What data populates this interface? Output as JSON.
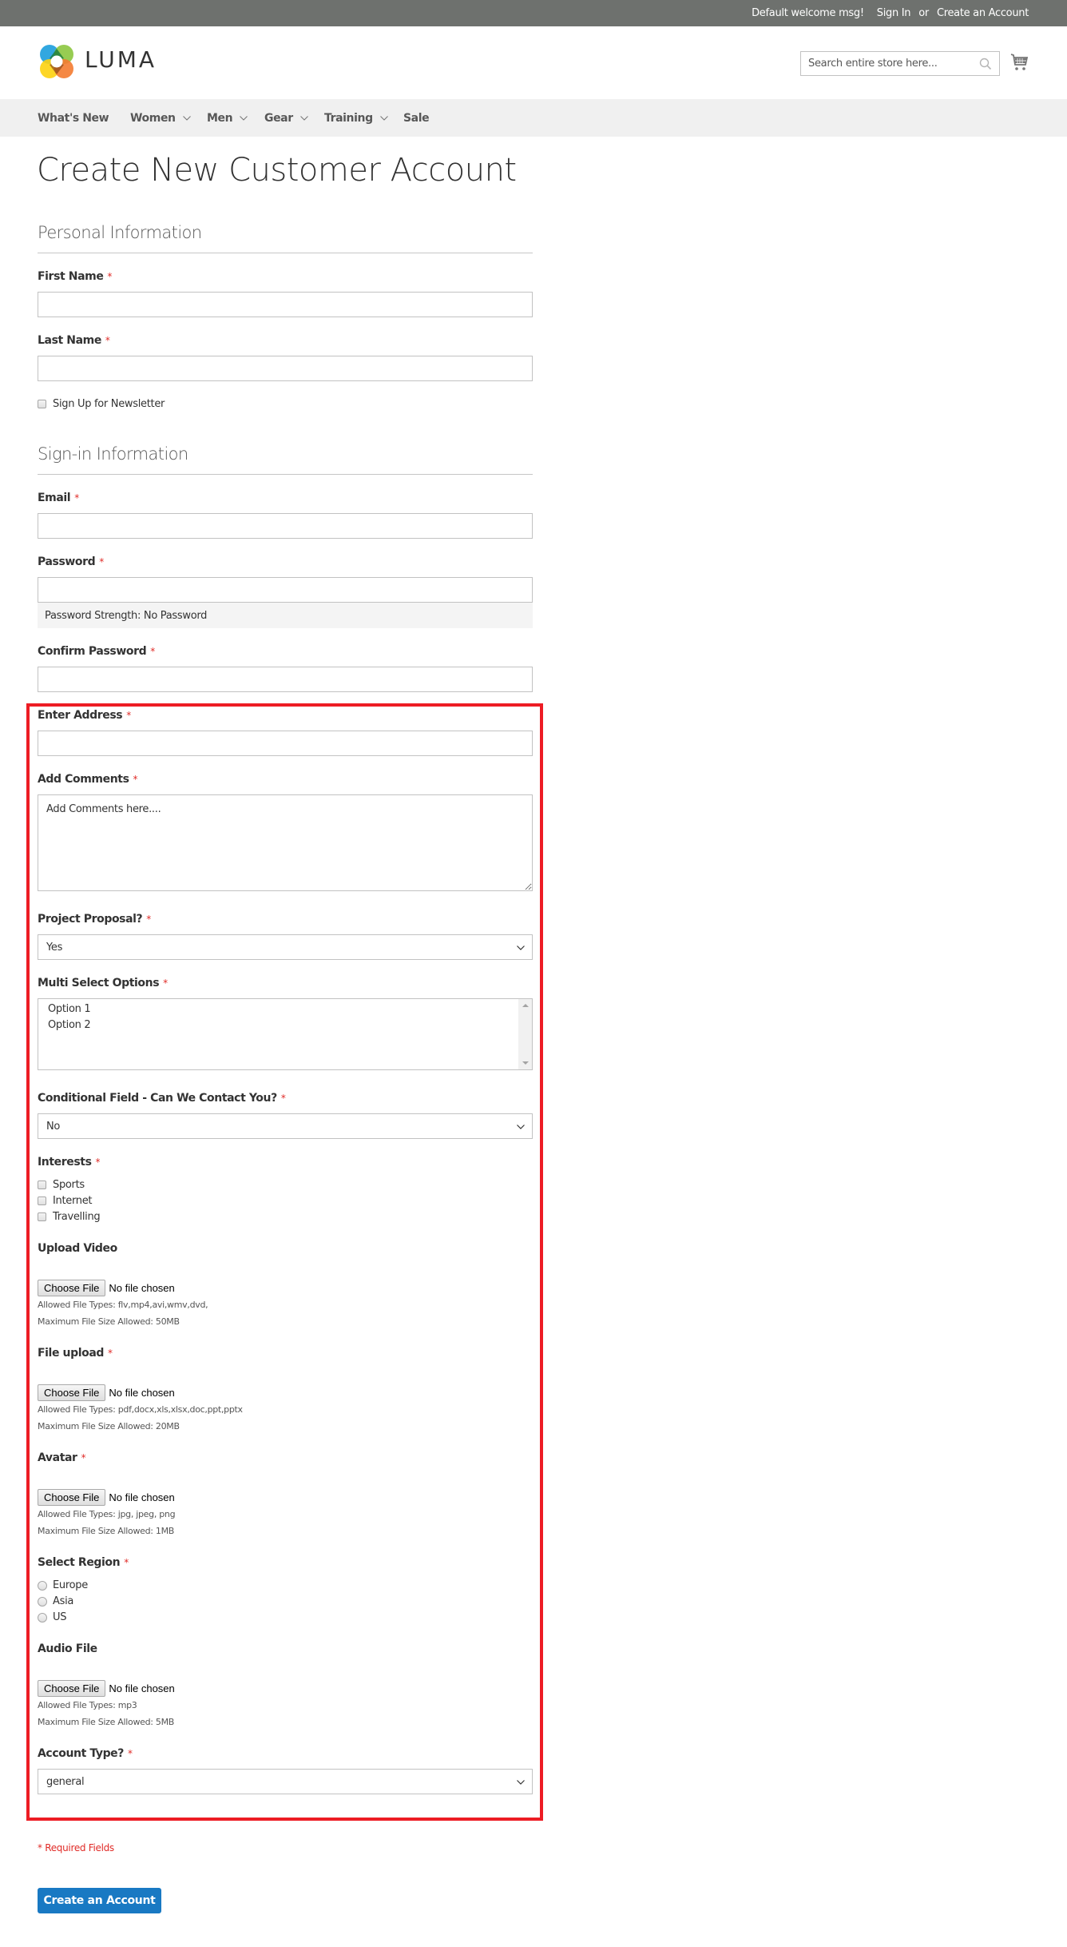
{
  "top_bar": {
    "welcome": "Default welcome msg!",
    "sign_in": "Sign In",
    "or": "or",
    "create_account": "Create an Account"
  },
  "header": {
    "logo_text": "LUMA",
    "search_placeholder": "Search entire store here..."
  },
  "nav": {
    "items": [
      {
        "label": "What's New",
        "has_submenu": false
      },
      {
        "label": "Women",
        "has_submenu": true
      },
      {
        "label": "Men",
        "has_submenu": true
      },
      {
        "label": "Gear",
        "has_submenu": true
      },
      {
        "label": "Training",
        "has_submenu": true
      },
      {
        "label": "Sale",
        "has_submenu": false
      }
    ]
  },
  "page": {
    "title": "Create New Customer Account"
  },
  "personal": {
    "legend": "Personal Information",
    "first_name_label": "First Name",
    "first_name_value": "",
    "last_name_label": "Last Name",
    "last_name_value": "",
    "newsletter_label": "Sign Up for Newsletter",
    "newsletter_checked": false
  },
  "signin": {
    "legend": "Sign-in Information",
    "email_label": "Email",
    "email_value": "",
    "password_label": "Password",
    "password_value": "",
    "password_strength": "Password Strength: No Password",
    "confirm_label": "Confirm Password",
    "confirm_value": ""
  },
  "custom": {
    "address_label": "Enter Address",
    "address_value": "",
    "comments_label": "Add Comments",
    "comments_placeholder": "Add Comments here....",
    "proposal_label": "Project Proposal?",
    "proposal_value": "Yes",
    "multi_label": "Multi Select Options",
    "multi_options": [
      "Option 1",
      "Option 2"
    ],
    "contact_label": "Conditional Field - Can We Contact You?",
    "contact_value": "No",
    "interests_label": "Interests",
    "interests": [
      {
        "label": "Sports",
        "checked": false
      },
      {
        "label": "Internet",
        "checked": false
      },
      {
        "label": "Travelling",
        "checked": false
      }
    ],
    "uploads": {
      "video": {
        "label": "Upload Video",
        "button": "Choose File",
        "status": "No file chosen",
        "allowed": "Allowed File Types: flv,mp4,avi,wmv,dvd,",
        "max": "Maximum File Size Allowed: 50MB"
      },
      "file": {
        "label": "File upload",
        "button": "Choose File",
        "status": "No file chosen",
        "allowed": "Allowed File Types: pdf,docx,xls,xlsx,doc,ppt,pptx",
        "max": "Maximum File Size Allowed: 20MB"
      },
      "avatar": {
        "label": "Avatar",
        "button": "Choose File",
        "status": "No file chosen",
        "allowed": "Allowed File Types: jpg, jpeg, png",
        "max": "Maximum File Size Allowed: 1MB"
      },
      "audio": {
        "label": "Audio File",
        "button": "Choose File",
        "status": "No file chosen",
        "allowed": "Allowed File Types: mp3",
        "max": "Maximum File Size Allowed: 5MB"
      }
    },
    "region_label": "Select Region",
    "regions": [
      {
        "label": "Europe",
        "selected": false
      },
      {
        "label": "Asia",
        "selected": false
      },
      {
        "label": "US",
        "selected": false
      }
    ],
    "account_type_label": "Account Type?",
    "account_type_value": "general"
  },
  "footer": {
    "required_note": "* Required Fields",
    "submit_label": "Create an Account"
  },
  "required_mark": "*",
  "colors": {
    "accent": "#1979c3",
    "required": "#e02b27",
    "highlight_border": "#ed1c24",
    "top_bar": "#6e716e",
    "nav_bg": "#f0f0f0"
  }
}
